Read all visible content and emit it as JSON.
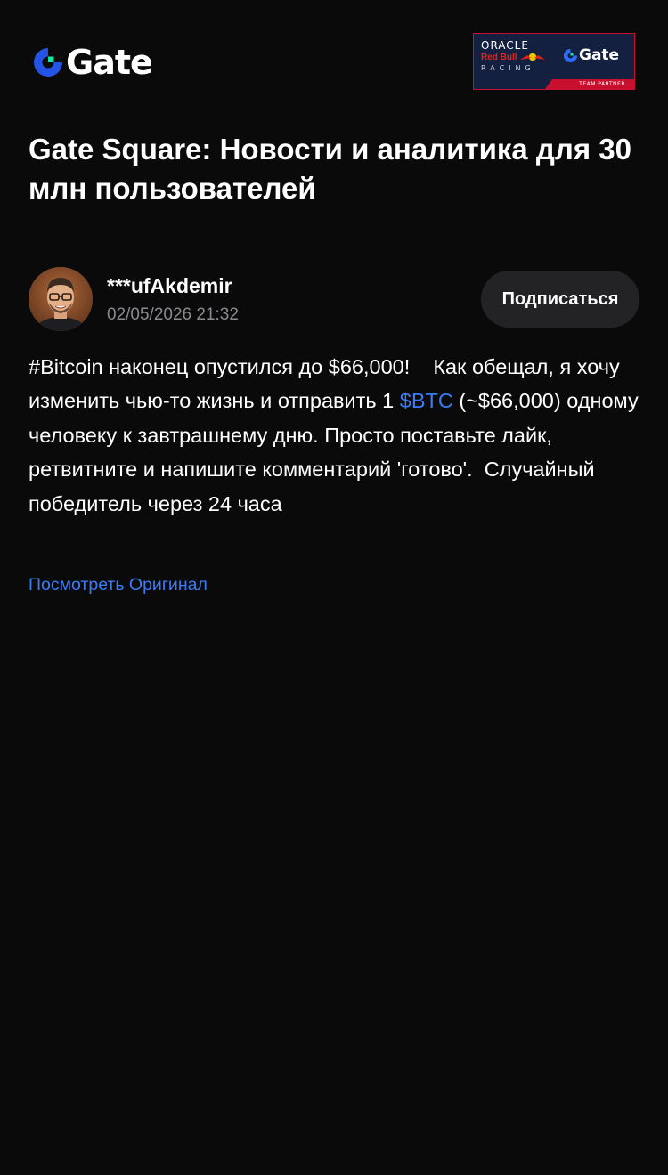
{
  "header": {
    "logo_text": "Gate",
    "partner": {
      "oracle": "ORACLE",
      "redbull_left": "Red Bull",
      "racing": "RACING",
      "gate_text": "Gate",
      "strip": "TEAM PARTNER"
    }
  },
  "page_title": "Gate Square: Новости и аналитика для 30 млн пользователей",
  "post": {
    "author": "***ufAkdemir",
    "timestamp": "02/05/2026 21:32",
    "follow_label": "Подписаться",
    "body_before": "#Bitcoin наконец опустился до $66,000!    Как обещал, я хочу изменить чью-то жизнь и отправить 1 ",
    "ticker": "$BTC",
    "body_after": " (~$66,000) одному человеку к завтрашнему дню. Просто поставьте лайк, ретвитните и напишите комментарий 'готово'.  Случайный победитель через 24 часа",
    "view_original": "Посмотреть Оригинал"
  },
  "colors": {
    "background": "#0a0a0b",
    "accent_link": "#3b7cf6",
    "brand_blue": "#2354e6",
    "brand_green": "#17e5a1",
    "muted_text": "#8a8a8f",
    "button_bg": "#232325"
  },
  "icons": {
    "logo": "gate-logo-icon",
    "avatar": "user-avatar"
  }
}
